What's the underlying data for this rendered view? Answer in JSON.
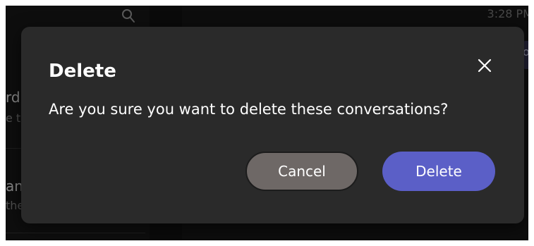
{
  "background": {
    "left_snippets": [
      {
        "text": "rd"
      },
      {
        "text": "e t"
      },
      {
        "text": "ani"
      },
      {
        "text": "the"
      }
    ],
    "timestamp": "3:28 PM",
    "bubble_letter": "o"
  },
  "dialog": {
    "title": "Delete",
    "message": "Are you sure you want to delete these conversations?",
    "cancel_label": "Cancel",
    "delete_label": "Delete",
    "close_icon": "close-icon"
  },
  "icons": {
    "search": "search-icon",
    "close": "close-icon"
  },
  "colors": {
    "dialog_bg": "#2a2a2a",
    "primary": "#5b5fc7",
    "secondary": "#6e6866",
    "text": "#ffffff"
  }
}
